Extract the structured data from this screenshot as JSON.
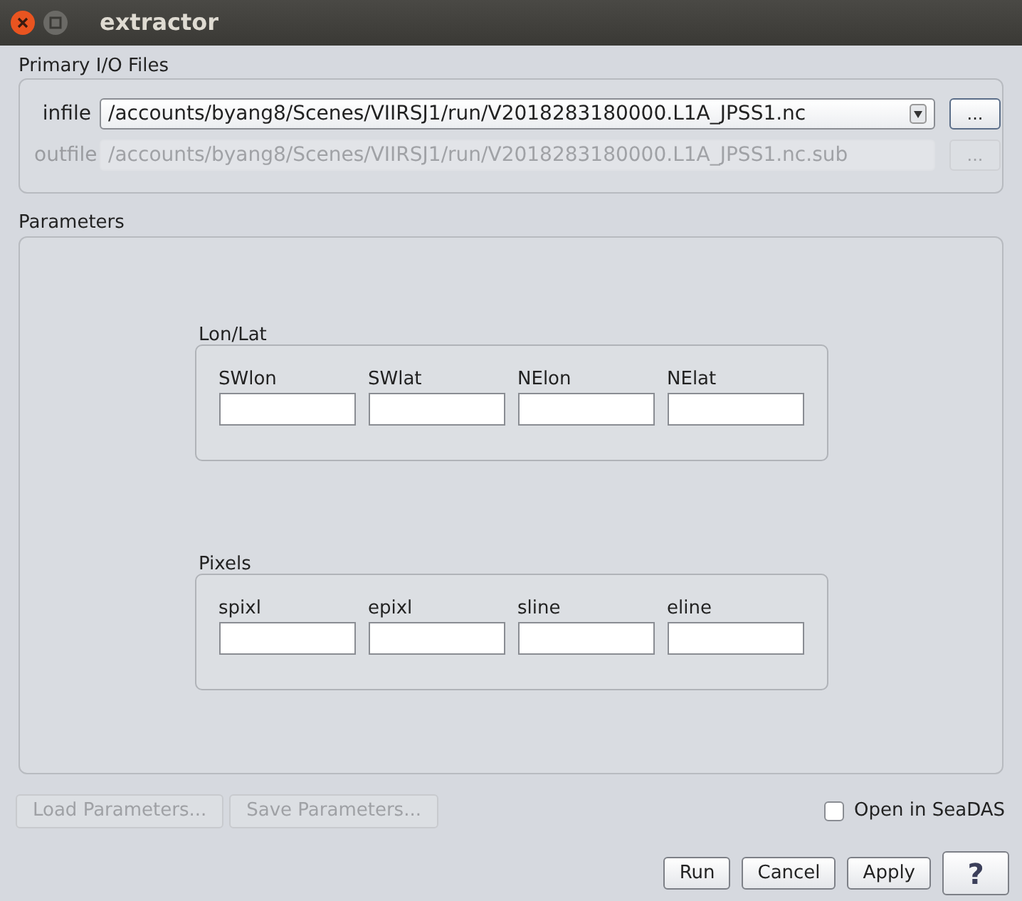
{
  "window": {
    "title": "extractor"
  },
  "io": {
    "title": "Primary I/O Files",
    "infile": {
      "label": "infile",
      "value": "/accounts/byang8/Scenes/VIIRSJ1/run/V2018283180000.L1A_JPSS1.nc",
      "browse": "...",
      "disabled": false
    },
    "outfile": {
      "label": "outfile",
      "value": "/accounts/byang8/Scenes/VIIRSJ1/run/V2018283180000.L1A_JPSS1.nc.sub",
      "browse": "...",
      "disabled": true
    }
  },
  "parameters": {
    "title": "Parameters",
    "groups": [
      {
        "title": "Lon/Lat",
        "fields": [
          {
            "label": "SWlon"
          },
          {
            "label": "SWlat"
          },
          {
            "label": "NElon"
          },
          {
            "label": "NElat"
          }
        ]
      },
      {
        "title": "Pixels",
        "fields": [
          {
            "label": "spixl"
          },
          {
            "label": "epixl"
          },
          {
            "label": "sline"
          },
          {
            "label": "eline"
          }
        ]
      }
    ]
  },
  "param_buttons": [
    {
      "label": "Load Parameters...",
      "disabled": true
    },
    {
      "label": "Save Parameters...",
      "disabled": true
    }
  ],
  "open_in_seadas": {
    "label": "Open in SeaDAS",
    "checked": false
  },
  "actions": [
    {
      "label": "Run"
    },
    {
      "label": "Cancel"
    },
    {
      "label": "Apply"
    }
  ],
  "help": {
    "label": "?"
  }
}
